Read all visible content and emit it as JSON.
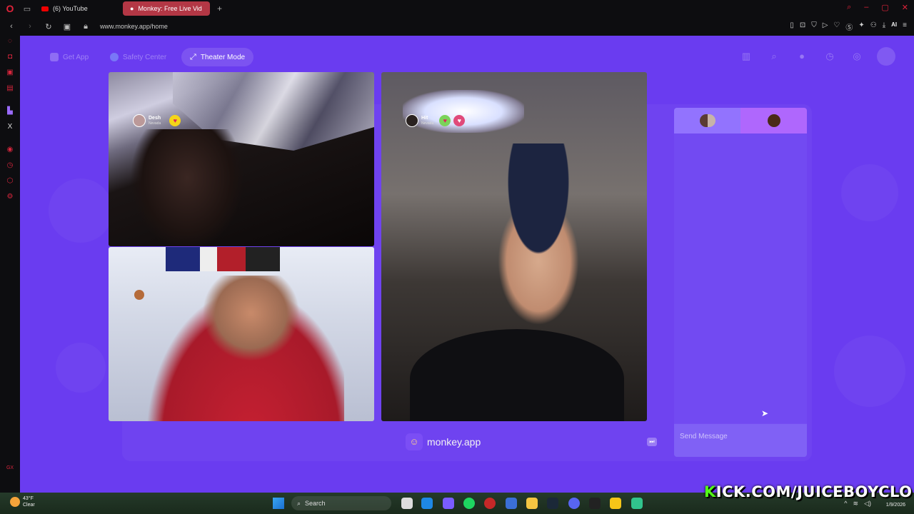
{
  "browser": {
    "tabs": [
      {
        "label": "(6) YouTube",
        "icon": "youtube-icon",
        "active": false
      },
      {
        "label": "Monkey: Free Live Vid",
        "icon": "monkey-icon",
        "active": true
      }
    ],
    "url": "www.monkey.app/home",
    "ai_label": "AI"
  },
  "nav": {
    "get_app": "Get App",
    "safety_center": "Safety Center",
    "theater_mode": "Theater Mode"
  },
  "videos": {
    "top_left": {
      "name": "Desh",
      "location": "Nevada"
    },
    "right": {
      "name": "Hit",
      "location": "Nevada"
    }
  },
  "brand": {
    "text": "monkey.app"
  },
  "chat": {
    "placeholder": "Send Message"
  },
  "taskbar": {
    "weather_temp": "43°F",
    "weather_desc": "Clear",
    "search": "Search",
    "date": "1/9/2026"
  },
  "overlay": {
    "kick_k": "K",
    "kick_rest": "ICK.COM/JUICEBOYCLO"
  },
  "colors": {
    "page_bg": "#6a3cf0",
    "kick_green": "#53fc18",
    "opera_red": "#e0233a"
  }
}
